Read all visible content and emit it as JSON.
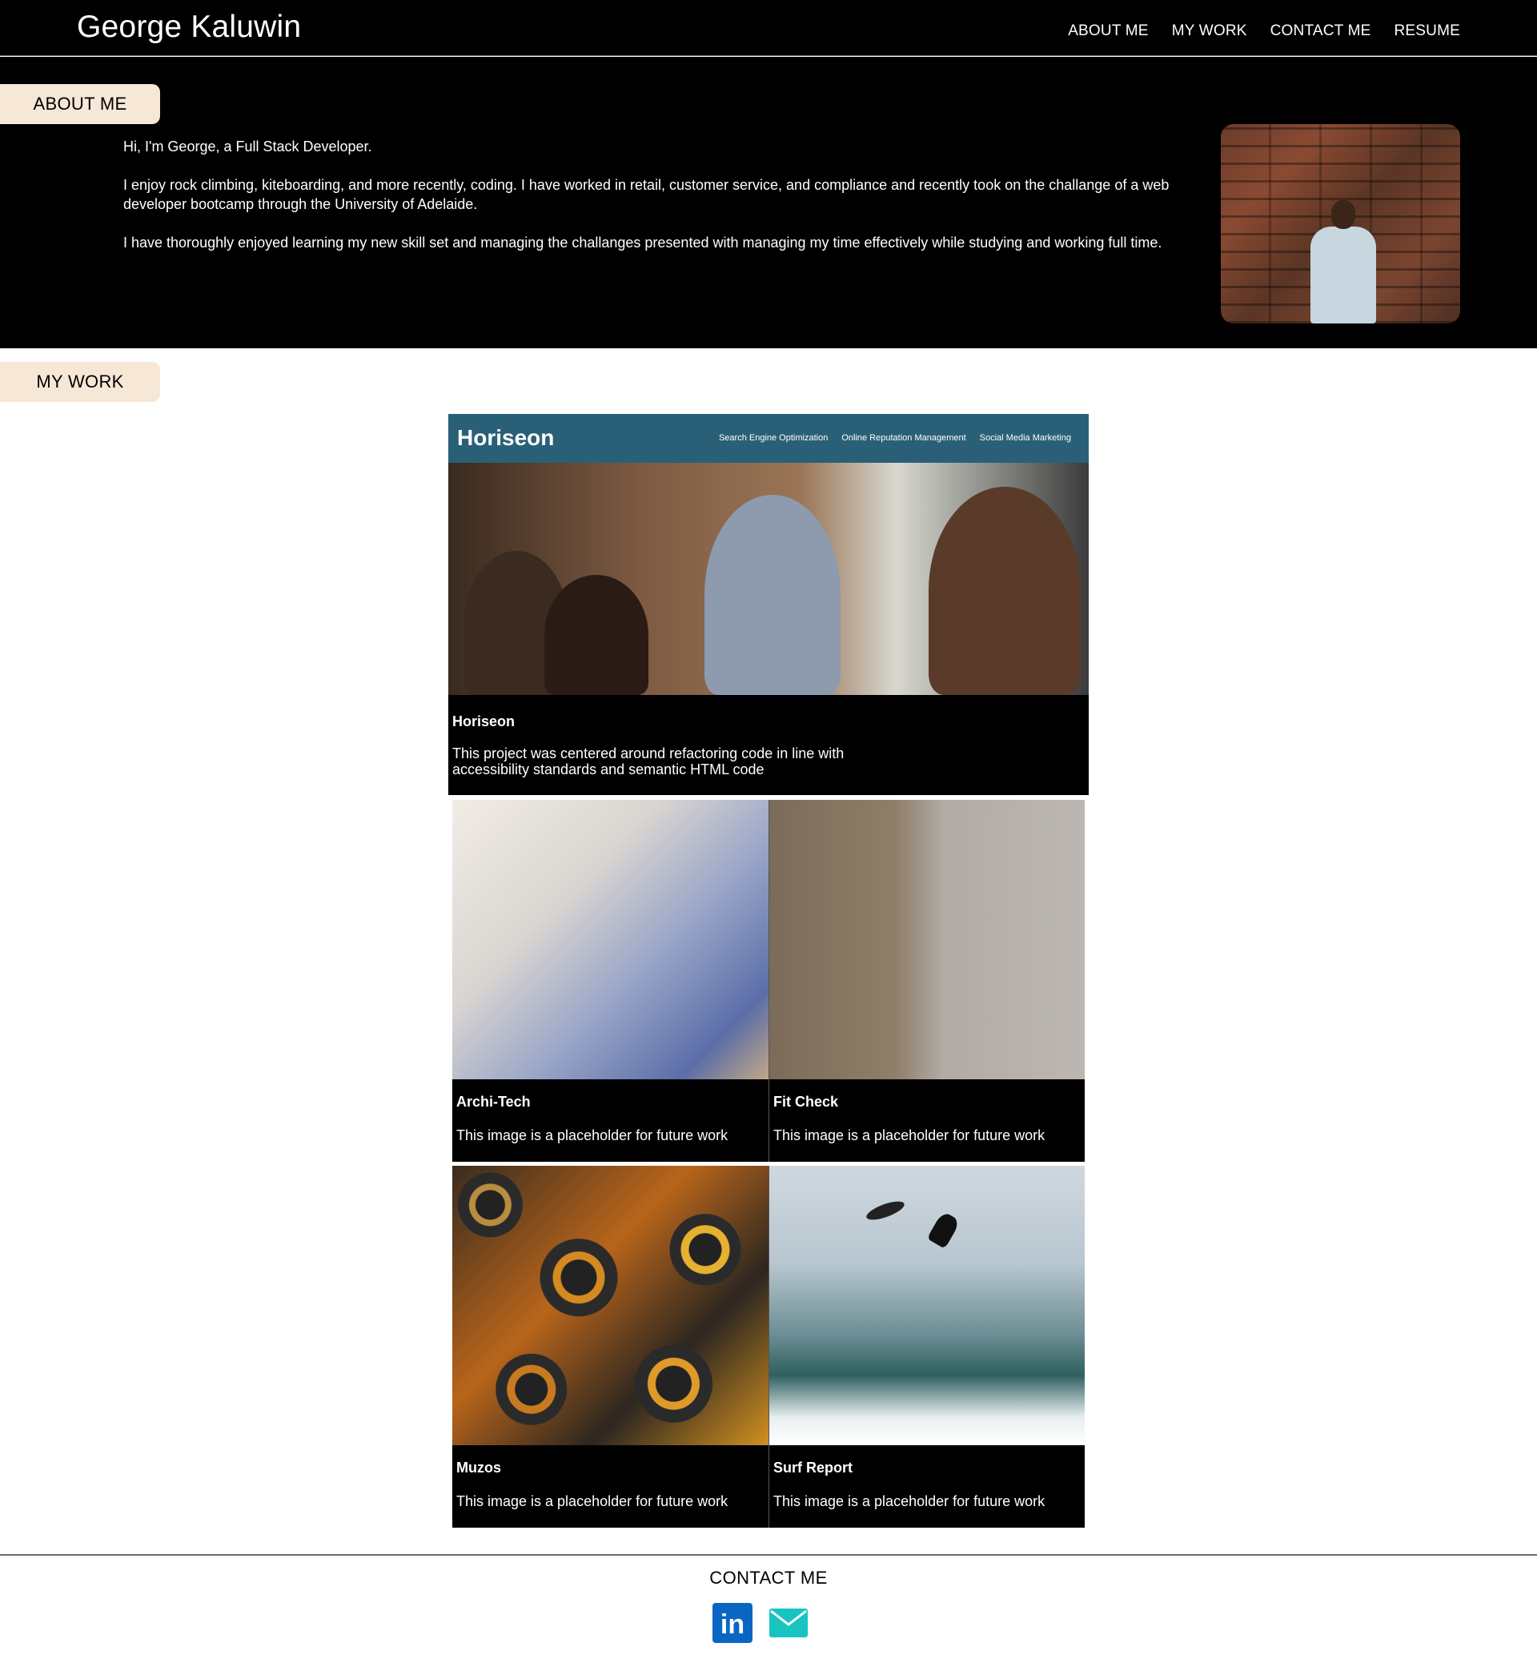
{
  "header": {
    "brand": "George Kaluwin",
    "nav": [
      "ABOUT ME",
      "MY WORK",
      "CONTACT ME",
      "RESUME"
    ]
  },
  "about": {
    "heading": "ABOUT ME",
    "paragraphs": [
      "Hi, I'm George, a Full Stack Developer.",
      "I enjoy rock climbing, kiteboarding, and more recently, coding. I have worked in retail, customer service, and compliance and recently took on the challange of a web developer bootcamp through the University of Adelaide.",
      "I have thoroughly enjoyed learning my new skill set and managing the challanges presented with managing my time effectively while studying and working full time."
    ]
  },
  "work": {
    "heading": "MY WORK",
    "featured": {
      "title": "Horiseon",
      "description": "This project was centered around refactoring code in line with accessibility standards and semantic HTML code",
      "preview": {
        "logo": "Horiseon",
        "links": [
          "Search Engine Optimization",
          "Online Reputation Management",
          "Social Media Marketing"
        ]
      }
    },
    "projects": [
      {
        "title": "Archi-Tech",
        "description": "This image is a placeholder for future work"
      },
      {
        "title": "Fit Check",
        "description": "This image is a placeholder for future work"
      },
      {
        "title": "Muzos",
        "description": "This image is a placeholder for future work"
      },
      {
        "title": "Surf Report",
        "description": "This image is a placeholder for future work"
      }
    ]
  },
  "contact": {
    "heading": "CONTACT ME",
    "icons": [
      "linkedin-icon",
      "email-icon"
    ],
    "colors": {
      "linkedin": "#0a66c2",
      "email": "#18c4c0"
    }
  },
  "colors": {
    "header_bg": "#000000",
    "tab_bg": "#f7e7d6",
    "horiseon_bar": "#2a6077"
  }
}
